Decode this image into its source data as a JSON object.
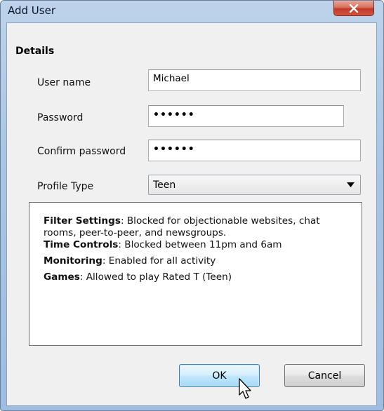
{
  "window": {
    "title": "Add User",
    "close_symbol": "x"
  },
  "details": {
    "title": "Details",
    "user_name_label": "User name",
    "user_name_value": "Michael",
    "password_label": "Password",
    "password_value": "••••••",
    "confirm_label": "Confirm password",
    "confirm_value": "••••••",
    "profile_label": "Profile Type",
    "profile_value": "Teen"
  },
  "info": {
    "filter_label": "Filter Settings",
    "filter_text": ": Blocked for objectionable websites, chat rooms, peer-to-peer, and newsgroups.",
    "time_label": "Time Controls",
    "time_text": ": Blocked between 11pm and 6am",
    "monitoring_label": "Monitoring",
    "monitoring_text": ": Enabled for all activity",
    "games_label": "Games",
    "games_text": ": Allowed to play Rated T (Teen)"
  },
  "buttons": {
    "ok": "OK",
    "cancel": "Cancel"
  },
  "icons": {
    "close": "close-icon",
    "dropdown": "chevron-down-icon",
    "cursor": "mouse-pointer-icon"
  }
}
